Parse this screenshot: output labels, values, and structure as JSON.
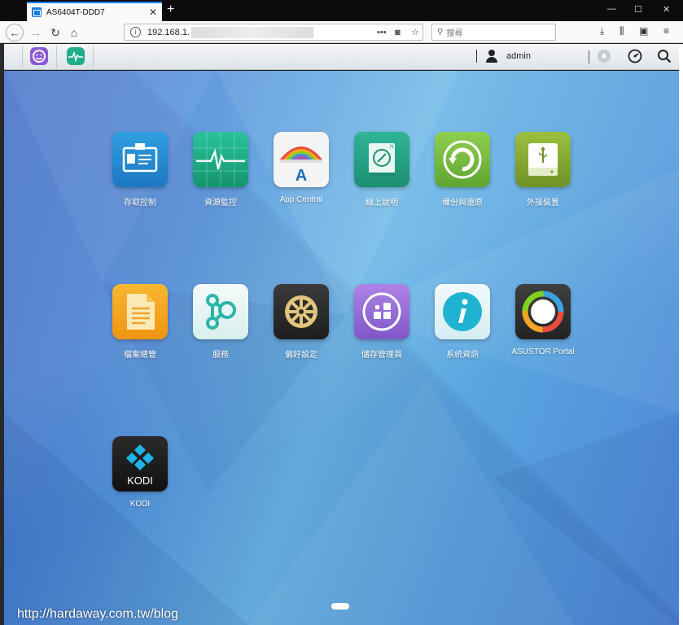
{
  "browser": {
    "tab_title": "AS6404T-DDD7",
    "tab_close": "✕",
    "new_tab": "+",
    "url_text": "192.168.1.",
    "url_more": "•••",
    "search_placeholder": "搜尋",
    "window_controls": [
      "—",
      "☐",
      "✕"
    ]
  },
  "taskbar": {
    "username": "admin"
  },
  "apps": [
    {
      "label": "存取控制",
      "icon": "access-control-icon",
      "color": "#2a8fd6"
    },
    {
      "label": "資源監控",
      "icon": "resource-monitor-icon",
      "color": "#1fae8a"
    },
    {
      "label": "App Central",
      "icon": "app-central-icon",
      "color": "#f3f3f3"
    },
    {
      "label": "線上說明",
      "icon": "online-help-icon",
      "color": "#2aa58b"
    },
    {
      "label": "備份與還原",
      "icon": "backup-restore-icon",
      "color": "#7cc243"
    },
    {
      "label": "外接裝置",
      "icon": "external-devices-icon",
      "color": "#8bb03a"
    },
    {
      "label": "檔案總管",
      "icon": "file-explorer-icon",
      "color": "#f5a623"
    },
    {
      "label": "服務",
      "icon": "services-icon",
      "color": "#e8f6f4"
    },
    {
      "label": "偏好設定",
      "icon": "preferences-icon",
      "color": "#2b2b2b"
    },
    {
      "label": "儲存管理員",
      "icon": "storage-manager-icon",
      "color": "#9b6fd6"
    },
    {
      "label": "系統資訊",
      "icon": "system-info-icon",
      "color": "#e6f4f8"
    },
    {
      "label": "ASUSTOR Portal",
      "icon": "asustor-portal-icon",
      "color": "#333333"
    },
    {
      "label": "KODI",
      "icon": "kodi-icon",
      "color": "#1a1a1a"
    }
  ],
  "kodi_text": "KODI",
  "watermark": "http://hardaway.com.tw/blog"
}
